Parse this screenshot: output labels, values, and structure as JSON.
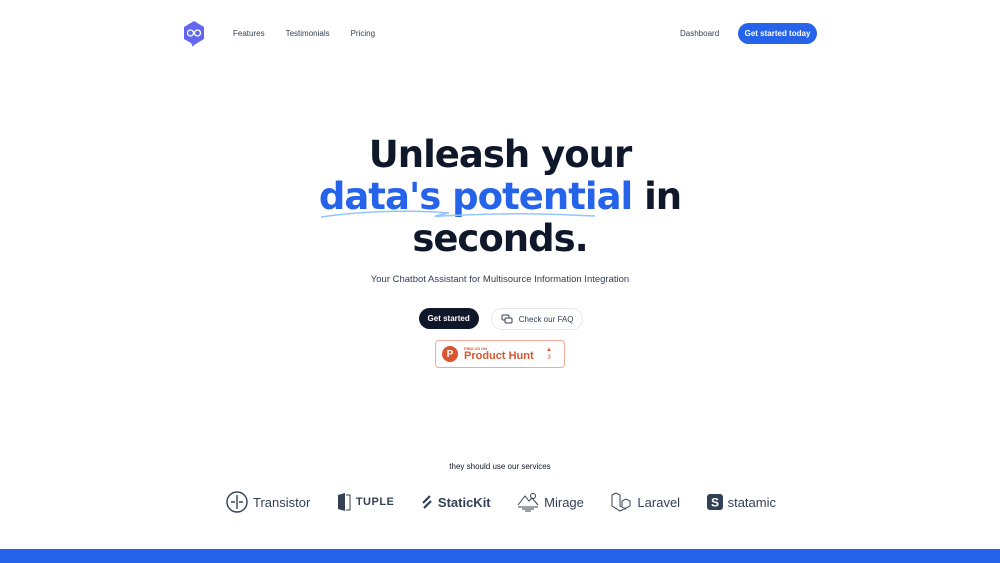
{
  "nav": {
    "links": [
      "Features",
      "Testimonials",
      "Pricing"
    ],
    "dashboard": "Dashboard",
    "cta": "Get started today"
  },
  "hero": {
    "line1": "Unleash your",
    "highlight": "data's potential",
    "line2_rest": " in",
    "line3": "seconds.",
    "subtitle": "Your Chatbot Assistant for Multisource Information Integration"
  },
  "buttons": {
    "primary": "Get started",
    "secondary": "Check our FAQ"
  },
  "product_hunt": {
    "small": "FIND US ON",
    "big": "Product Hunt",
    "votes": "3",
    "letter": "P"
  },
  "clients": {
    "heading": "they should use our services",
    "logos": [
      "Transistor",
      "TUPLE",
      "StaticKit",
      "Mirage",
      "Laravel",
      "statamic"
    ]
  },
  "colors": {
    "accent": "#2563eb",
    "dark": "#0f172a",
    "logo": "#6366f1",
    "product_hunt": "#da552f"
  }
}
